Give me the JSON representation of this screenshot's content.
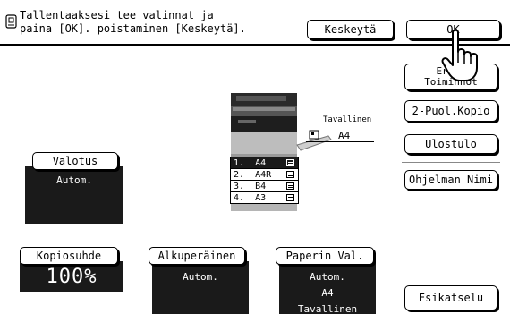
{
  "message": {
    "line1": "Tallentaaksesi tee valinnat ja",
    "line2": "paina [OK]. poistaminen [Keskeytä]."
  },
  "buttons": {
    "cancel": "Keskeytä",
    "ok": "OK",
    "special_modes_line1": "Erit.",
    "special_modes_line2": "Toiminnot",
    "duplex": "2-Puol.Kopio",
    "output": "Ulostulo",
    "program_name": "Ohjelman Nimi",
    "preview": "Esikatselu"
  },
  "exposure": {
    "label": "Valotus",
    "value": "Autom."
  },
  "ratio": {
    "label": "Kopiosuhde",
    "value": "100%"
  },
  "original": {
    "label": "Alkuperäinen",
    "value": "Autom."
  },
  "paper": {
    "label": "Paperin Val.",
    "value1": "Autom.",
    "value2": "A4",
    "value3": "Tavallinen"
  },
  "bypass_tray": {
    "type": "Tavallinen",
    "size": "A4"
  },
  "trays": [
    {
      "label": "1.  A4"
    },
    {
      "label": "2.  A4R"
    },
    {
      "label": "3.  B4"
    },
    {
      "label": "4.  A3"
    }
  ],
  "colors": {
    "panel": "#1a1a1a",
    "background": "#ffffff"
  }
}
